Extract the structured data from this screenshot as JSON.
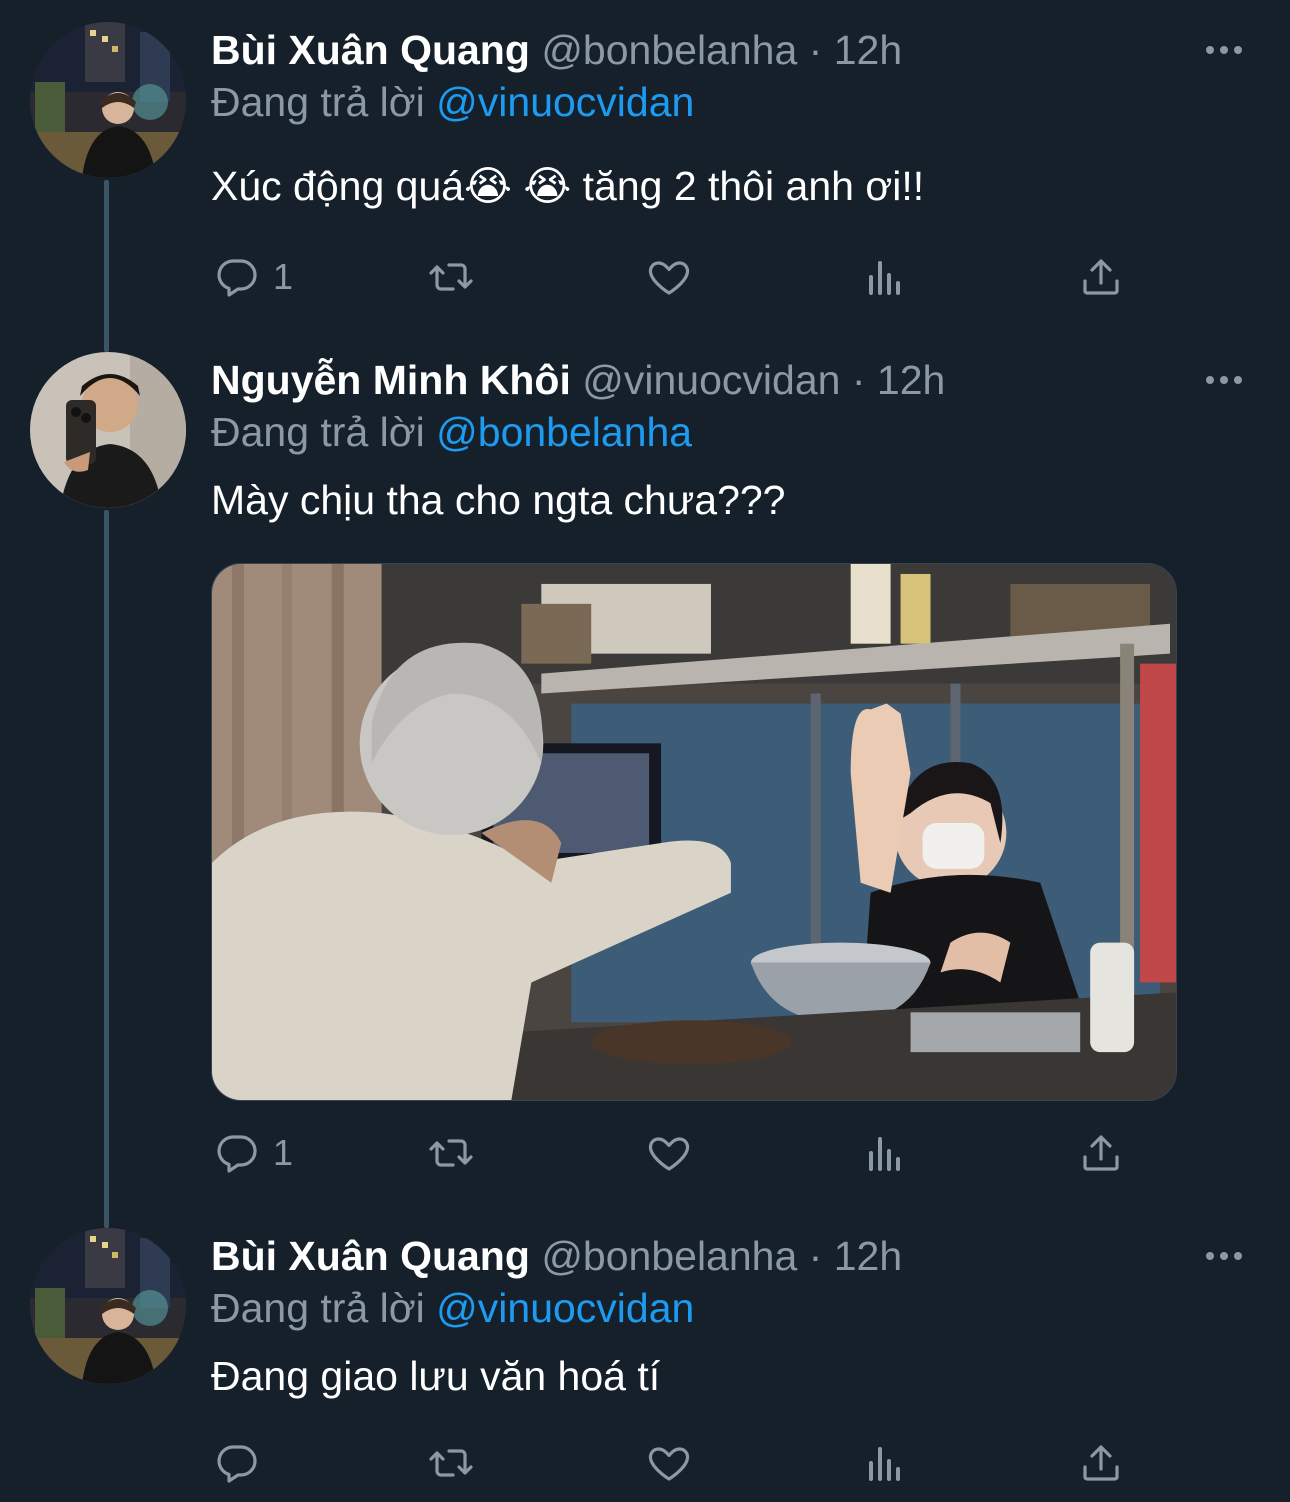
{
  "thread": {
    "tweets": [
      {
        "name": "Bùi Xuân Quang",
        "handle": "@bonbelanha",
        "separator": "·",
        "time": "12h",
        "reply_prefix": "Đang trả lời",
        "reply_to": "@vinuocvidan",
        "text": "Xúc động quá😭 😭  tăng 2 thôi anh ơi!!",
        "reply_count": "1",
        "avatar_icon": "avatar-city-night"
      },
      {
        "name": "Nguyễn Minh Khôi",
        "handle": "@vinuocvidan",
        "separator": "·",
        "time": "12h",
        "reply_prefix": "Đang trả lời",
        "reply_to": "@bonbelanha",
        "text": "Mày chịu tha cho ngta chưa???",
        "reply_count": "1",
        "avatar_icon": "avatar-mirror-selfie",
        "media": "photo-high-five-kitchen"
      },
      {
        "name": "Bùi Xuân Quang",
        "handle": "@bonbelanha",
        "separator": "·",
        "time": "12h",
        "reply_prefix": "Đang trả lời",
        "reply_to": "@vinuocvidan",
        "text": "Đang giao lưu văn hoá tí",
        "reply_count": "",
        "avatar_icon": "avatar-city-night"
      }
    ]
  },
  "colors": {
    "background": "#15202b",
    "primary_text": "#ffffff",
    "secondary_text": "#8b98a5",
    "link": "#1d9bf0",
    "thread_line": "#3d5466"
  },
  "icons": [
    "reply-icon",
    "retweet-icon",
    "like-icon",
    "analytics-icon",
    "share-icon",
    "more-icon"
  ]
}
